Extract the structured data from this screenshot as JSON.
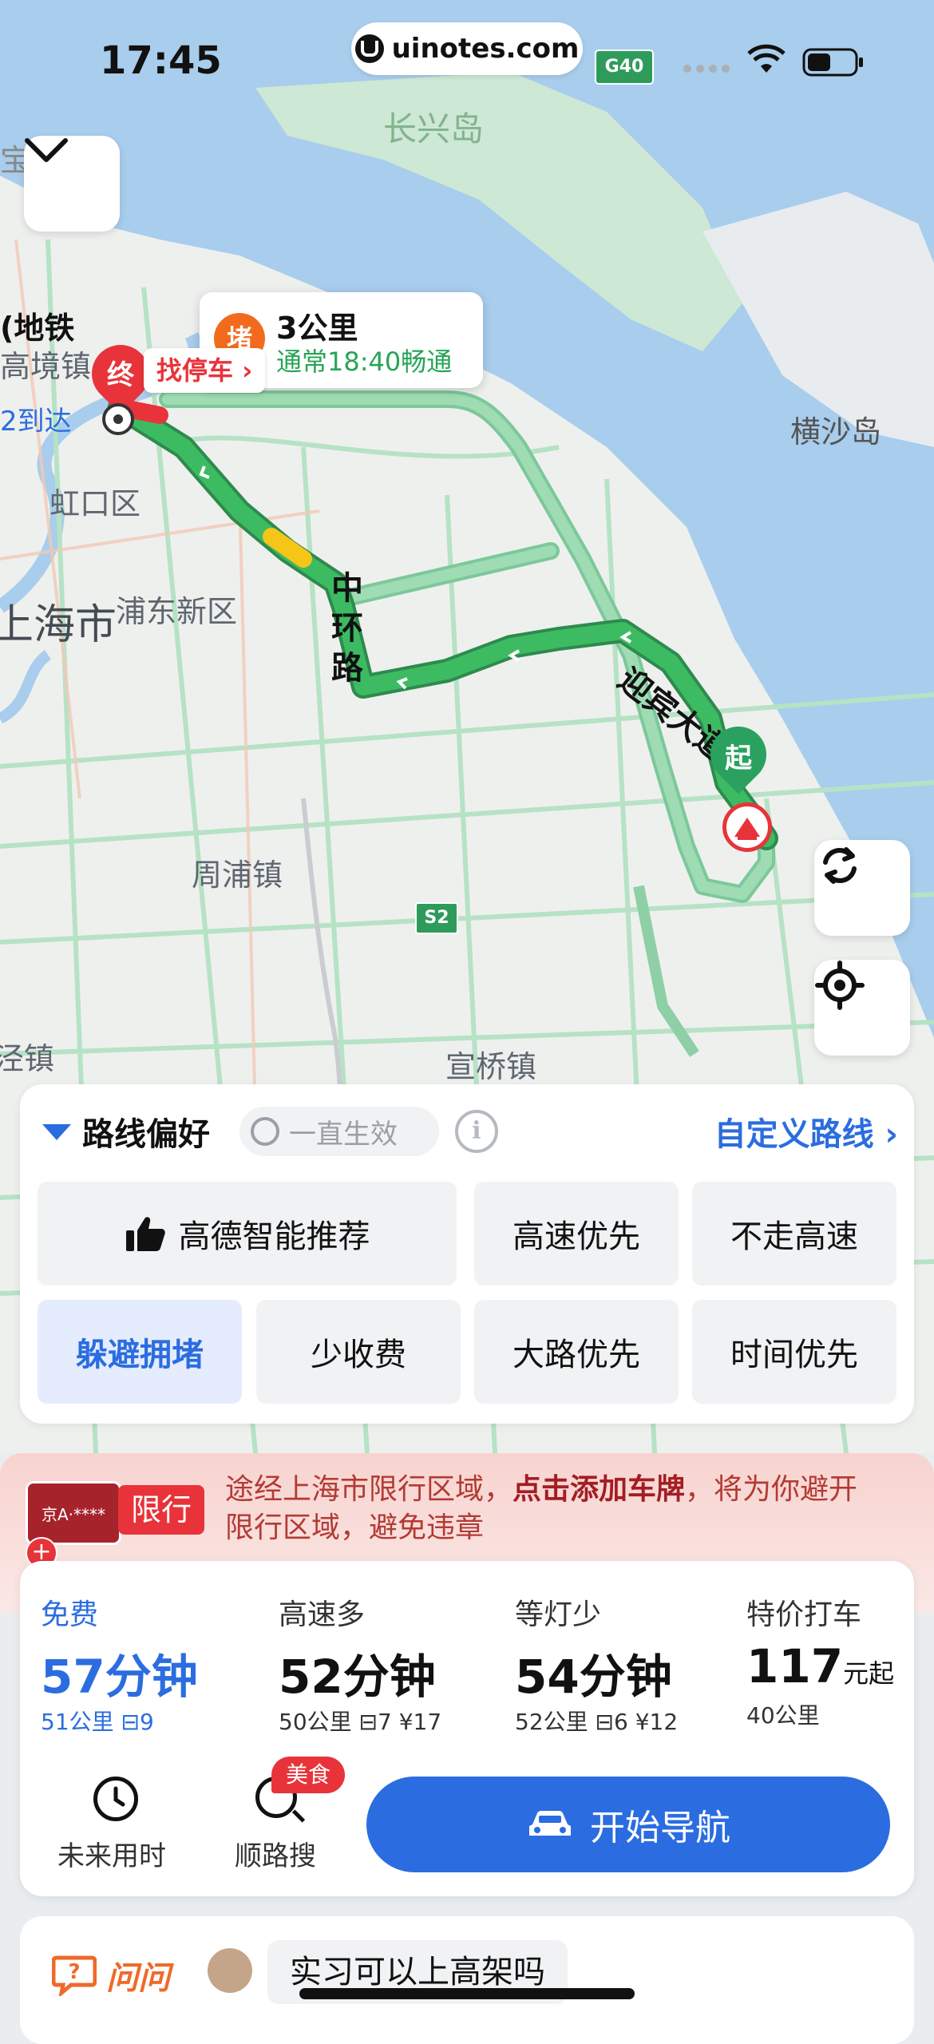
{
  "status_bar": {
    "time": "17:45",
    "url": "uinotes.com",
    "road_badge": "G40"
  },
  "map": {
    "labels": {
      "changxing": "长兴岛",
      "hengsha": "横沙岛",
      "hongkou": "虹口区",
      "shanghai": "上海市",
      "pudong": "浦东新区",
      "zhoupu": "周浦镇",
      "xuanqiao": "宣桥镇",
      "metro": "(地铁",
      "gaojing": "高境镇",
      "arrive": "2到达",
      "zhen_left": "泾镇",
      "ring_road": "中环路",
      "yingbin": "迎宾大道",
      "s2": "S2",
      "cut_top": "宝"
    },
    "callout": {
      "jam_icon": "堵",
      "distance": "3公里",
      "eta": "通常18:40畅通"
    },
    "end_marker": "终",
    "parking_chip": "找停车 ›",
    "start_marker": "起"
  },
  "preferences": {
    "title": "路线偏好",
    "always_label": "一直生效",
    "info_icon": "i",
    "custom_route": "自定义路线 ›",
    "options": [
      {
        "label": "高德智能推荐",
        "active": false,
        "icon": "thumbs-up-icon"
      },
      {
        "label": "高速优先",
        "active": false
      },
      {
        "label": "不走高速",
        "active": false
      },
      {
        "label": "躲避拥堵",
        "active": true
      },
      {
        "label": "少收费",
        "active": false
      },
      {
        "label": "大路优先",
        "active": false
      },
      {
        "label": "时间优先",
        "active": false
      }
    ]
  },
  "restriction": {
    "plate": "京A·****",
    "plate_plus": "+",
    "tag": "限行",
    "text_before": "途经上海市限行区域，",
    "text_bold": "点击添加车牌",
    "text_after": "，将为你避开限行区域，避免违章"
  },
  "routes": [
    {
      "label": "免费",
      "time": "57分钟",
      "meta": "51公里 ⊟9",
      "selected": true
    },
    {
      "label": "高速多",
      "time": "52分钟",
      "meta": "50公里 ⊟7 ¥17",
      "selected": false
    },
    {
      "label": "等灯少",
      "time": "54分钟",
      "meta": "52公里 ⊟6 ¥12",
      "selected": false
    },
    {
      "label": "特价打车",
      "time": "117",
      "time_suffix": "元起",
      "meta": "40公里",
      "selected": false
    }
  ],
  "actions": {
    "future": "未来用时",
    "search": "顺路搜",
    "food_badge": "美食",
    "navigate": "开始导航"
  },
  "ask": {
    "logo": "问问",
    "question": "实习可以上高架吗"
  },
  "colors": {
    "accent": "#2b6de0",
    "route_green": "#3dbb62",
    "alert_red": "#e8333a"
  }
}
